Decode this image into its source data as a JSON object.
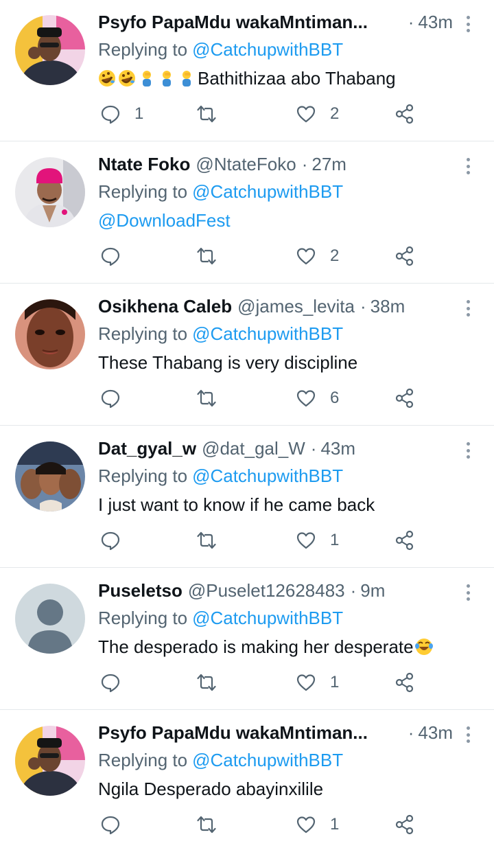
{
  "colors": {
    "link": "#1d9bf0",
    "muted": "#536471",
    "divider": "#e4e8eb"
  },
  "replies": [
    {
      "name": "Psyfo PapaMdu wakaMntiman...",
      "handle": "",
      "time": "43m",
      "replying_label": "Replying to",
      "replying_to": "@CatchupwithBBT",
      "text": "Bathithizaa abo Thabang",
      "emojis": [
        "rolling-laughing-emoji",
        "rolling-laughing-emoji",
        "facepalm-emoji",
        "facepalm-emoji",
        "facepalm-emoji"
      ],
      "reply_count": "1",
      "like_count": "2"
    },
    {
      "name": "Ntate Foko",
      "handle": "@NtateFoko",
      "time": "27m",
      "replying_label": "Replying to",
      "replying_to": "@CatchupwithBBT",
      "text": "@DownloadFest",
      "reply_count": "",
      "like_count": "2"
    },
    {
      "name": "Osikhena Caleb",
      "handle": "@james_levita",
      "time": "38m",
      "replying_label": "Replying to",
      "replying_to": "@CatchupwithBBT",
      "text": "These Thabang is very discipline",
      "reply_count": "",
      "like_count": "6"
    },
    {
      "name": "Dat_gyal_w",
      "handle": "@dat_gal_W",
      "time": "43m",
      "replying_label": "Replying to",
      "replying_to": "@CatchupwithBBT",
      "text": "I just want to know if he came back",
      "reply_count": "",
      "like_count": "1"
    },
    {
      "name": "Puseletso",
      "handle": "@Puselet12628483",
      "time": "9m",
      "replying_label": "Replying to",
      "replying_to": "@CatchupwithBBT",
      "text": "The desperado is making her desperate",
      "trailing_emoji": "joy-emoji",
      "reply_count": "",
      "like_count": "1"
    },
    {
      "name": "Psyfo PapaMdu wakaMntiman...",
      "handle": "",
      "time": "43m",
      "replying_label": "Replying to",
      "replying_to": "@CatchupwithBBT",
      "text": "Ngila Desperado abayinxilile",
      "reply_count": "",
      "like_count": "1"
    }
  ]
}
